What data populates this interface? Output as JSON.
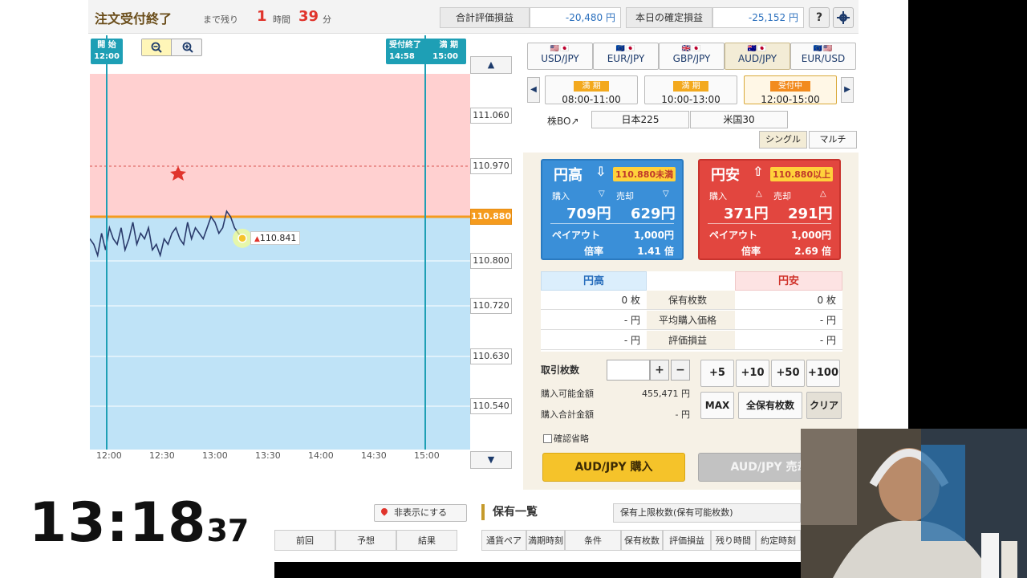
{
  "header": {
    "order_status": "注文受付終了",
    "remaining_label": "まで残り",
    "hours": "1",
    "hours_unit": "時間",
    "minutes": "39",
    "minutes_unit": "分",
    "total_pl_label": "合計評価損益",
    "total_pl_value": "-20,480 円",
    "today_pl_label": "本日の確定損益",
    "today_pl_value": "-25,152 円",
    "help_icon": "?",
    "settings_icon": "gear-icon"
  },
  "chart": {
    "start_tag": [
      "開 始",
      "12:00"
    ],
    "accept_end_tag": [
      "受付終了",
      "14:58"
    ],
    "expiry_tag": [
      "満 期",
      "15:00"
    ],
    "current_price_label": "110.841",
    "x_ticks": [
      "12:00",
      "12:30",
      "13:00",
      "13:30",
      "14:00",
      "14:30",
      "15:00"
    ],
    "y_ticks": [
      "111.060",
      "110.970",
      "110.880",
      "110.800",
      "110.720",
      "110.630",
      "110.540"
    ],
    "strike": "110.880",
    "colors": {
      "upper_zone": "#ffd0d0",
      "lower_zone": "#bfe3f7",
      "line": "#2a3a6b",
      "strike_line": "#f59b1e"
    }
  },
  "chart_data": {
    "type": "line",
    "title": "",
    "xlabel": "",
    "ylabel": "",
    "x_ticks": [
      "12:00",
      "12:30",
      "13:00",
      "13:30",
      "14:00",
      "14:30",
      "15:00"
    ],
    "xlim": [
      "12:00",
      "15:00"
    ],
    "ylim": [
      110.5,
      111.1
    ],
    "series": [
      {
        "x": [
          "12:00",
          "12:02",
          "12:04",
          "12:06",
          "12:08",
          "12:10",
          "12:12",
          "12:14",
          "12:16",
          "12:18",
          "12:20",
          "12:22",
          "12:24",
          "12:26",
          "12:28",
          "12:30",
          "12:32",
          "12:34",
          "12:36",
          "12:38",
          "12:40",
          "12:42",
          "12:44",
          "12:46",
          "12:48",
          "12:50",
          "12:52",
          "12:54",
          "12:56",
          "12:58",
          "13:00",
          "13:02",
          "13:04",
          "13:06",
          "13:08",
          "13:10",
          "13:12",
          "13:14",
          "13:16",
          "13:18"
        ],
        "values": [
          110.84,
          110.83,
          110.81,
          110.85,
          110.82,
          110.86,
          110.84,
          110.83,
          110.86,
          110.82,
          110.84,
          110.87,
          110.83,
          110.85,
          110.84,
          110.86,
          110.82,
          110.83,
          110.81,
          110.84,
          110.83,
          110.85,
          110.86,
          110.84,
          110.83,
          110.87,
          110.84,
          110.86,
          110.85,
          110.84,
          110.86,
          110.88,
          110.87,
          110.85,
          110.86,
          110.89,
          110.88,
          110.86,
          110.85,
          110.841
        ]
      }
    ],
    "hlines": [
      110.97,
      110.88
    ]
  },
  "pairs": [
    {
      "flags": "🇺🇸🇯🇵",
      "label": "USD/JPY"
    },
    {
      "flags": "🇪🇺🇯🇵",
      "label": "EUR/JPY"
    },
    {
      "flags": "🇬🇧🇯🇵",
      "label": "GBP/JPY"
    },
    {
      "flags": "🇦🇺🇯🇵",
      "label": "AUD/JPY"
    },
    {
      "flags": "🇪🇺🇺🇸",
      "label": "EUR/USD"
    }
  ],
  "sessions": [
    {
      "badge": "満 期",
      "time": "08:00-11:00"
    },
    {
      "badge": "満 期",
      "time": "10:00-13:00"
    },
    {
      "badge": "受付中",
      "time": "12:00-15:00"
    }
  ],
  "stock": {
    "label": "株BO↗",
    "btn1": "日本225",
    "btn2": "米国30"
  },
  "modes": {
    "single": "シングル",
    "multi": "マルチ"
  },
  "up_card": {
    "title": "円高",
    "arrow": "⇩",
    "condition": "110.880未満",
    "buy_label": "購入",
    "sell_label": "売却",
    "buy_price": "709円",
    "sell_price": "629円",
    "payout_label": "ペイアウト",
    "payout_value": "1,000円",
    "rate_label": "倍率",
    "rate_value": "1.41 倍"
  },
  "down_card": {
    "title": "円安",
    "arrow": "⇧",
    "condition": "110.880以上",
    "buy_label": "購入",
    "sell_label": "売却",
    "buy_price": "371円",
    "sell_price": "291円",
    "payout_label": "ペイアウト",
    "payout_value": "1,000円",
    "rate_label": "倍率",
    "rate_value": "2.69 倍"
  },
  "holdings": {
    "head_up": "円高",
    "head_down": "円安",
    "rows": [
      {
        "up": "0 枚",
        "label": "保有枚数",
        "down": "0 枚"
      },
      {
        "up": "- 円",
        "label": "平均購入価格",
        "down": "- 円"
      },
      {
        "up": "- 円",
        "label": "評価損益",
        "down": "- 円"
      }
    ]
  },
  "order": {
    "qty_label": "取引枚数",
    "qty_value": "",
    "plus": "+",
    "minus": "−",
    "available_label": "購入可能金額",
    "available_value": "455,471 円",
    "total_label": "購入合計金額",
    "total_value": "- 円",
    "add_buttons": [
      "+5",
      "+10",
      "+50",
      "+100"
    ],
    "max": "MAX",
    "all_hold": "全保有枚数",
    "clear": "クリア",
    "confirm_skip": "確認省略",
    "buy_btn": "AUD/JPY 購入",
    "sell_btn": "AUD/JPY 売却"
  },
  "bottom": {
    "hide_btn": "非表示にする",
    "hold_list_title": "保有一覧",
    "hold_limit": "保有上限枚数(保有可能枚数)",
    "left_cols": [
      "前回",
      "予想",
      "結果"
    ],
    "right_cols": [
      "通貨ペア",
      "満期時刻",
      "条件",
      "保有枚数",
      "評価損益",
      "残り時間",
      "約定時刻"
    ]
  },
  "overlay_clock": {
    "main": "13:18",
    "seconds": "37"
  }
}
